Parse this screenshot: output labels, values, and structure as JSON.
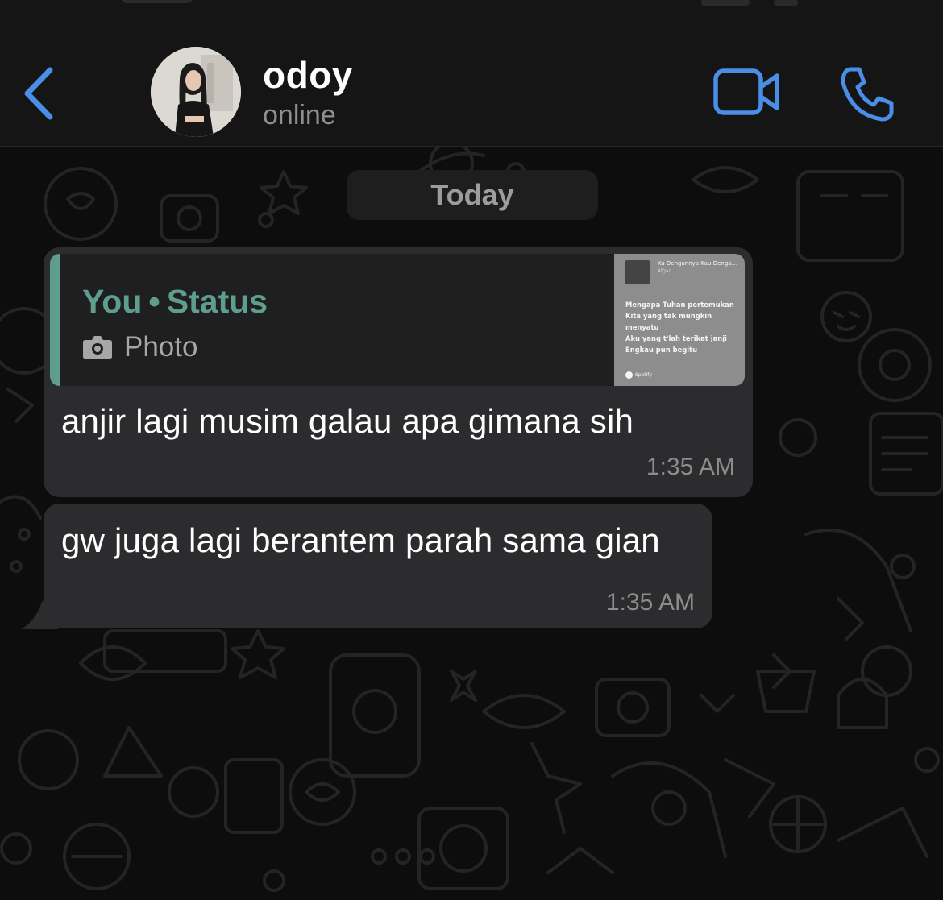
{
  "header": {
    "contact_name": "odoy",
    "contact_status": "online",
    "accent_color": "#4a8fe7"
  },
  "chat": {
    "date_separator": "Today",
    "messages": [
      {
        "reply": {
          "sender": "You",
          "separator": "•",
          "source": "Status",
          "media_type": "Photo",
          "media_icon": "camera-icon",
          "thumbnail": {
            "song": "Ku Dengannya Kau Denga...",
            "artist": "Afgan",
            "lyrics": [
              "Mengapa Tuhan pertemukan",
              "Kita yang tak mungkin",
              "menyatu",
              "Aku yang t'lah terikat janji",
              "Engkau pun begitu"
            ],
            "footer": "Spotify"
          }
        },
        "text": "anjir lagi musim galau apa gimana sih",
        "time": "1:35 AM"
      },
      {
        "text": "gw juga lagi berantem parah sama gian",
        "time": "1:35 AM"
      }
    ]
  }
}
